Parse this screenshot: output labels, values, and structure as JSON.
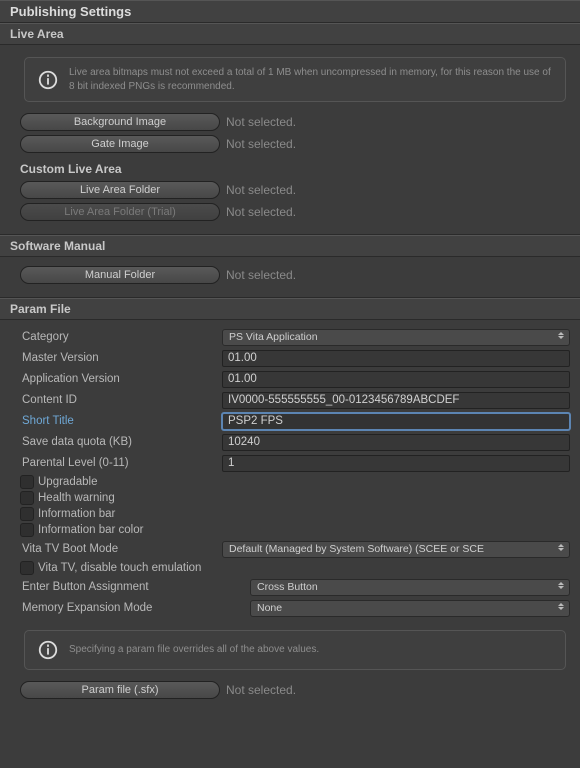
{
  "header": "Publishing Settings",
  "liveArea": {
    "title": "Live Area",
    "info": "Live area bitmaps must not exceed a total of 1 MB when uncompressed in memory, for this reason the use of 8 bit indexed PNGs is recommended.",
    "backgroundImageBtn": "Background Image",
    "backgroundImageVal": "Not selected.",
    "gateImageBtn": "Gate Image",
    "gateImageVal": "Not selected.",
    "customTitle": "Custom Live Area",
    "folderBtn": "Live Area Folder",
    "folderVal": "Not selected.",
    "folderTrialBtn": "Live Area Folder (Trial)",
    "folderTrialVal": "Not selected."
  },
  "manual": {
    "title": "Software Manual",
    "folderBtn": "Manual Folder",
    "folderVal": "Not selected."
  },
  "param": {
    "title": "Param File",
    "categoryLabel": "Category",
    "categoryValue": "PS Vita Application",
    "masterVersionLabel": "Master Version",
    "masterVersionValue": "01.00",
    "appVersionLabel": "Application Version",
    "appVersionValue": "01.00",
    "contentIdLabel": "Content ID",
    "contentIdValue": "IV0000-555555555_00-0123456789ABCDEF",
    "shortTitleLabel": "Short Title",
    "shortTitleValue": "PSP2 FPS",
    "saveQuotaLabel": "Save data quota (KB)",
    "saveQuotaValue": "10240",
    "parentalLabel": "Parental Level (0-11)",
    "parentalValue": "1",
    "upgradable": "Upgradable",
    "healthWarning": "Health warning",
    "infoBar": "Information bar",
    "infoBarColor": "Information bar color",
    "vitaTvBootLabel": "Vita TV Boot Mode",
    "vitaTvBootValue": "Default (Managed by System Software) (SCEE or SCE",
    "vitaTvDisableTouch": "Vita TV, disable touch emulation",
    "enterBtnLabel": "Enter Button Assignment",
    "enterBtnValue": "Cross Button",
    "memExpLabel": "Memory Expansion Mode",
    "memExpValue": "None",
    "overrideInfo": "Specifying a param file overrides all of the above values.",
    "paramFileBtn": "Param file (.sfx)",
    "paramFileVal": "Not selected."
  }
}
